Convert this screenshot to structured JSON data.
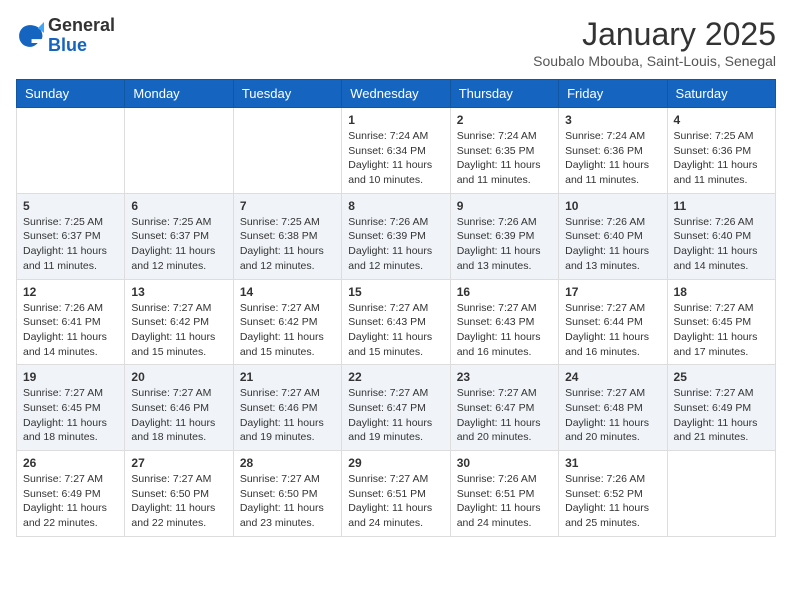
{
  "header": {
    "logo_line1": "General",
    "logo_line2": "Blue",
    "month_title": "January 2025",
    "subtitle": "Soubalo Mbouba, Saint-Louis, Senegal"
  },
  "days_of_week": [
    "Sunday",
    "Monday",
    "Tuesday",
    "Wednesday",
    "Thursday",
    "Friday",
    "Saturday"
  ],
  "weeks": [
    [
      {
        "day": "",
        "info": ""
      },
      {
        "day": "",
        "info": ""
      },
      {
        "day": "",
        "info": ""
      },
      {
        "day": "1",
        "info": "Sunrise: 7:24 AM\nSunset: 6:34 PM\nDaylight: 11 hours and 10 minutes."
      },
      {
        "day": "2",
        "info": "Sunrise: 7:24 AM\nSunset: 6:35 PM\nDaylight: 11 hours and 11 minutes."
      },
      {
        "day": "3",
        "info": "Sunrise: 7:24 AM\nSunset: 6:36 PM\nDaylight: 11 hours and 11 minutes."
      },
      {
        "day": "4",
        "info": "Sunrise: 7:25 AM\nSunset: 6:36 PM\nDaylight: 11 hours and 11 minutes."
      }
    ],
    [
      {
        "day": "5",
        "info": "Sunrise: 7:25 AM\nSunset: 6:37 PM\nDaylight: 11 hours and 11 minutes."
      },
      {
        "day": "6",
        "info": "Sunrise: 7:25 AM\nSunset: 6:37 PM\nDaylight: 11 hours and 12 minutes."
      },
      {
        "day": "7",
        "info": "Sunrise: 7:25 AM\nSunset: 6:38 PM\nDaylight: 11 hours and 12 minutes."
      },
      {
        "day": "8",
        "info": "Sunrise: 7:26 AM\nSunset: 6:39 PM\nDaylight: 11 hours and 12 minutes."
      },
      {
        "day": "9",
        "info": "Sunrise: 7:26 AM\nSunset: 6:39 PM\nDaylight: 11 hours and 13 minutes."
      },
      {
        "day": "10",
        "info": "Sunrise: 7:26 AM\nSunset: 6:40 PM\nDaylight: 11 hours and 13 minutes."
      },
      {
        "day": "11",
        "info": "Sunrise: 7:26 AM\nSunset: 6:40 PM\nDaylight: 11 hours and 14 minutes."
      }
    ],
    [
      {
        "day": "12",
        "info": "Sunrise: 7:26 AM\nSunset: 6:41 PM\nDaylight: 11 hours and 14 minutes."
      },
      {
        "day": "13",
        "info": "Sunrise: 7:27 AM\nSunset: 6:42 PM\nDaylight: 11 hours and 15 minutes."
      },
      {
        "day": "14",
        "info": "Sunrise: 7:27 AM\nSunset: 6:42 PM\nDaylight: 11 hours and 15 minutes."
      },
      {
        "day": "15",
        "info": "Sunrise: 7:27 AM\nSunset: 6:43 PM\nDaylight: 11 hours and 15 minutes."
      },
      {
        "day": "16",
        "info": "Sunrise: 7:27 AM\nSunset: 6:43 PM\nDaylight: 11 hours and 16 minutes."
      },
      {
        "day": "17",
        "info": "Sunrise: 7:27 AM\nSunset: 6:44 PM\nDaylight: 11 hours and 16 minutes."
      },
      {
        "day": "18",
        "info": "Sunrise: 7:27 AM\nSunset: 6:45 PM\nDaylight: 11 hours and 17 minutes."
      }
    ],
    [
      {
        "day": "19",
        "info": "Sunrise: 7:27 AM\nSunset: 6:45 PM\nDaylight: 11 hours and 18 minutes."
      },
      {
        "day": "20",
        "info": "Sunrise: 7:27 AM\nSunset: 6:46 PM\nDaylight: 11 hours and 18 minutes."
      },
      {
        "day": "21",
        "info": "Sunrise: 7:27 AM\nSunset: 6:46 PM\nDaylight: 11 hours and 19 minutes."
      },
      {
        "day": "22",
        "info": "Sunrise: 7:27 AM\nSunset: 6:47 PM\nDaylight: 11 hours and 19 minutes."
      },
      {
        "day": "23",
        "info": "Sunrise: 7:27 AM\nSunset: 6:47 PM\nDaylight: 11 hours and 20 minutes."
      },
      {
        "day": "24",
        "info": "Sunrise: 7:27 AM\nSunset: 6:48 PM\nDaylight: 11 hours and 20 minutes."
      },
      {
        "day": "25",
        "info": "Sunrise: 7:27 AM\nSunset: 6:49 PM\nDaylight: 11 hours and 21 minutes."
      }
    ],
    [
      {
        "day": "26",
        "info": "Sunrise: 7:27 AM\nSunset: 6:49 PM\nDaylight: 11 hours and 22 minutes."
      },
      {
        "day": "27",
        "info": "Sunrise: 7:27 AM\nSunset: 6:50 PM\nDaylight: 11 hours and 22 minutes."
      },
      {
        "day": "28",
        "info": "Sunrise: 7:27 AM\nSunset: 6:50 PM\nDaylight: 11 hours and 23 minutes."
      },
      {
        "day": "29",
        "info": "Sunrise: 7:27 AM\nSunset: 6:51 PM\nDaylight: 11 hours and 24 minutes."
      },
      {
        "day": "30",
        "info": "Sunrise: 7:26 AM\nSunset: 6:51 PM\nDaylight: 11 hours and 24 minutes."
      },
      {
        "day": "31",
        "info": "Sunrise: 7:26 AM\nSunset: 6:52 PM\nDaylight: 11 hours and 25 minutes."
      },
      {
        "day": "",
        "info": ""
      }
    ]
  ]
}
